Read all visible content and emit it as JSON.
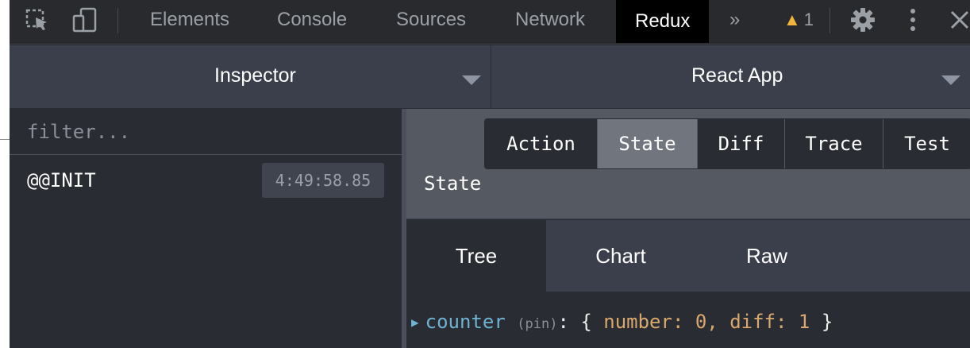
{
  "devtools": {
    "tabs": [
      "Elements",
      "Console",
      "Sources",
      "Network",
      "Redux"
    ],
    "active_tab": "Redux",
    "more_glyph": "»",
    "warning_count": "1",
    "colors": {
      "tabbar_bg": "#292a2d",
      "active_tab_bg": "#000000",
      "warning": "#f2b43c"
    }
  },
  "redux": {
    "monitor_select": "Inspector",
    "instance_select": "React App",
    "filter_placeholder": "filter...",
    "actions": [
      {
        "name": "@@INIT",
        "time": "4:49:58.85"
      }
    ],
    "detail_tabs": [
      "Action",
      "State",
      "Diff",
      "Trace",
      "Test"
    ],
    "selected_detail_tab": "State",
    "detail_title": "State",
    "view_tabs": [
      "Tree",
      "Chart",
      "Raw"
    ],
    "selected_view_tab": "Tree",
    "tree": {
      "key": "counter",
      "pin": "(pin)",
      "colon": ":",
      "open": "{",
      "number_label": "number:",
      "number_value": "0,",
      "diff_label": "diff:",
      "diff_value": "1",
      "close": "}"
    },
    "colors": {
      "key": "#6fb3d2",
      "value": "#d9a86c",
      "panel_bg": "#2a2c33",
      "header_bg": "#3a3f4b"
    }
  }
}
